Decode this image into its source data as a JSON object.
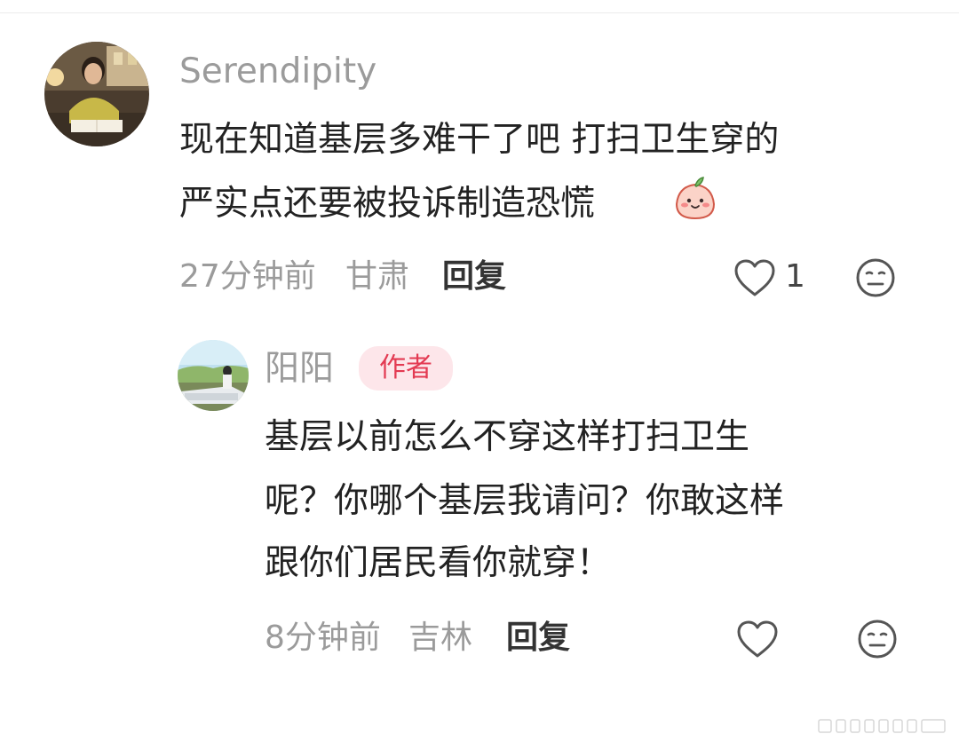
{
  "comments": [
    {
      "username": "Serendipity",
      "text_line1": "现在知道基层多难干了吧 打扫卫生穿的",
      "text_line2": "严实点还要被投诉制造恐慌",
      "time": "27分钟前",
      "location": "甘肃",
      "reply_label": "回复",
      "like_count": "1"
    },
    {
      "username": "阳阳",
      "author_badge": "作者",
      "text_line1": "基层以前怎么不穿这样打扫卫生",
      "text_line2": "呢？你哪个基层我请问？你敢这样",
      "text_line3": "跟你们居民看你就穿！",
      "time": "8分钟前",
      "location": "吉林",
      "reply_label": "回复"
    }
  ],
  "icons": {
    "like": "heart-outline-icon",
    "emoji": "neutral-face-icon",
    "sticker": "peach-smile-sticker"
  }
}
